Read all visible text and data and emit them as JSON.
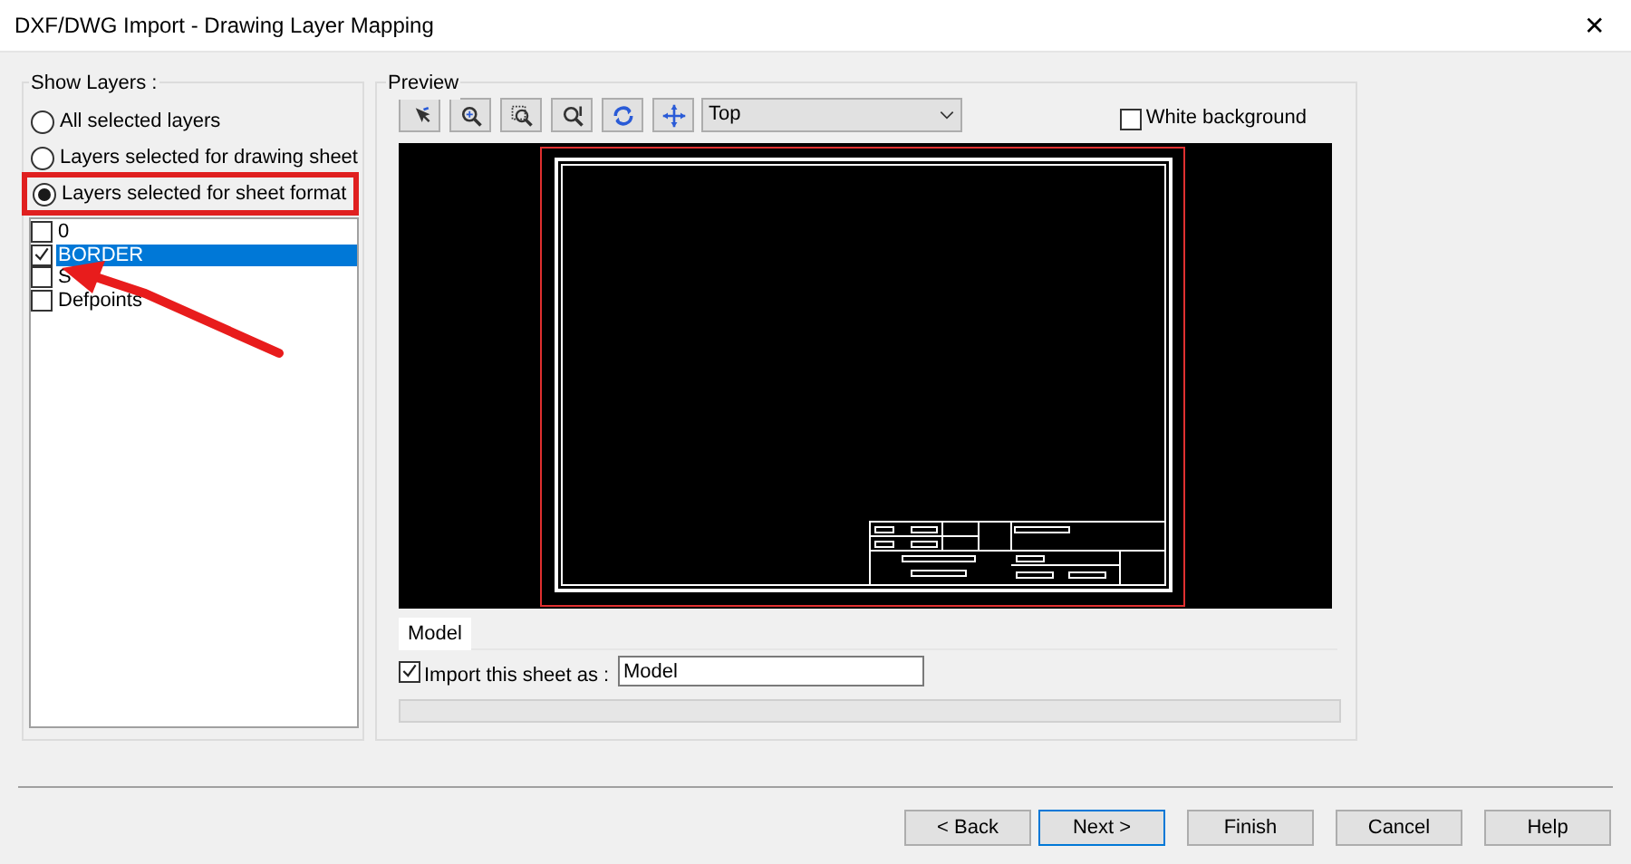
{
  "window": {
    "title": "DXF/DWG Import - Drawing Layer Mapping",
    "close": "✕"
  },
  "show_layers": {
    "title": "Show Layers :",
    "options": [
      {
        "label": "All selected layers",
        "selected": false
      },
      {
        "label": "Layers selected for drawing sheet",
        "selected": false
      },
      {
        "label": "Layers selected for sheet format",
        "selected": true,
        "highlighted": true
      }
    ],
    "layers": [
      {
        "name": "0",
        "checked": false,
        "selected": false
      },
      {
        "name": "BORDER",
        "checked": true,
        "selected": true
      },
      {
        "name": "S",
        "checked": false,
        "selected": false
      },
      {
        "name": "Defpoints",
        "checked": false,
        "selected": false
      }
    ]
  },
  "preview": {
    "title": "Preview",
    "view": "Top",
    "white_background": {
      "label": "White background",
      "checked": false
    },
    "tabs": [
      {
        "label": "Model",
        "selected": true
      }
    ],
    "import_sheet": {
      "label": "Import this sheet as :",
      "checked": true,
      "value": "Model"
    }
  },
  "buttons": [
    {
      "label": "< Back",
      "default": false
    },
    {
      "label": "Next >",
      "default": true
    },
    {
      "label": "Finish",
      "default": false
    },
    {
      "label": "Cancel",
      "default": false
    },
    {
      "label": "Help",
      "default": false
    }
  ]
}
